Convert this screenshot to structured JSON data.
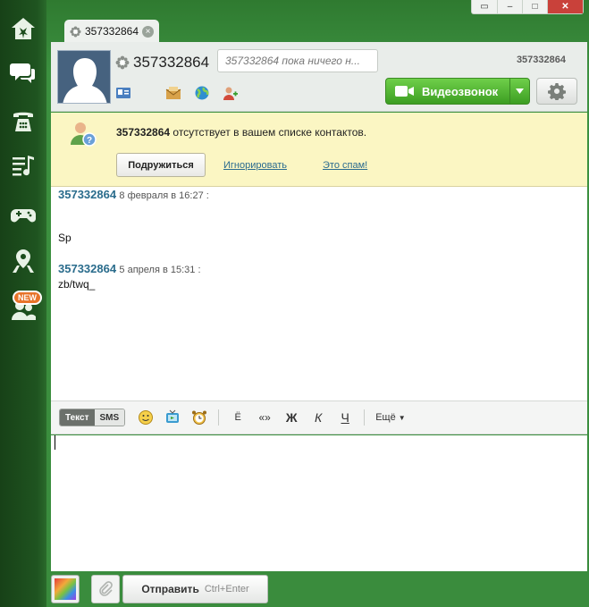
{
  "window": {
    "controls": [
      "▭",
      "–",
      "□",
      "✕"
    ]
  },
  "tab": {
    "label": "357332864",
    "close": "×"
  },
  "header": {
    "contact_name": "357332864",
    "status_placeholder": "357332864 пока ничего н...",
    "contact_id": "357332864",
    "video_call_label": "Видеозвонок"
  },
  "notice": {
    "name": "357332864",
    "text": " отсутствует в вашем списке контактов.",
    "add_friend": "Подружиться",
    "ignore": "Игнорировать",
    "spam": "Это спам!"
  },
  "messages": [
    {
      "sender": "357332864",
      "time": "8 февраля в 16:27 :",
      "text": "Sp"
    },
    {
      "sender": "357332864",
      "time": "5 апреля в 15:31 :",
      "text": "zb/twq_"
    }
  ],
  "toolbar": {
    "mode_text": "Текст",
    "mode_sms": "SMS",
    "translit": "Ё",
    "quotes": "«»",
    "bold": "Ж",
    "italic": "К",
    "underline": "Ч",
    "more": "Ещё"
  },
  "sidebar": {
    "new_badge": "NEW"
  },
  "bottom": {
    "send_label": "Отправить",
    "send_hint": "Ctrl+Enter"
  }
}
